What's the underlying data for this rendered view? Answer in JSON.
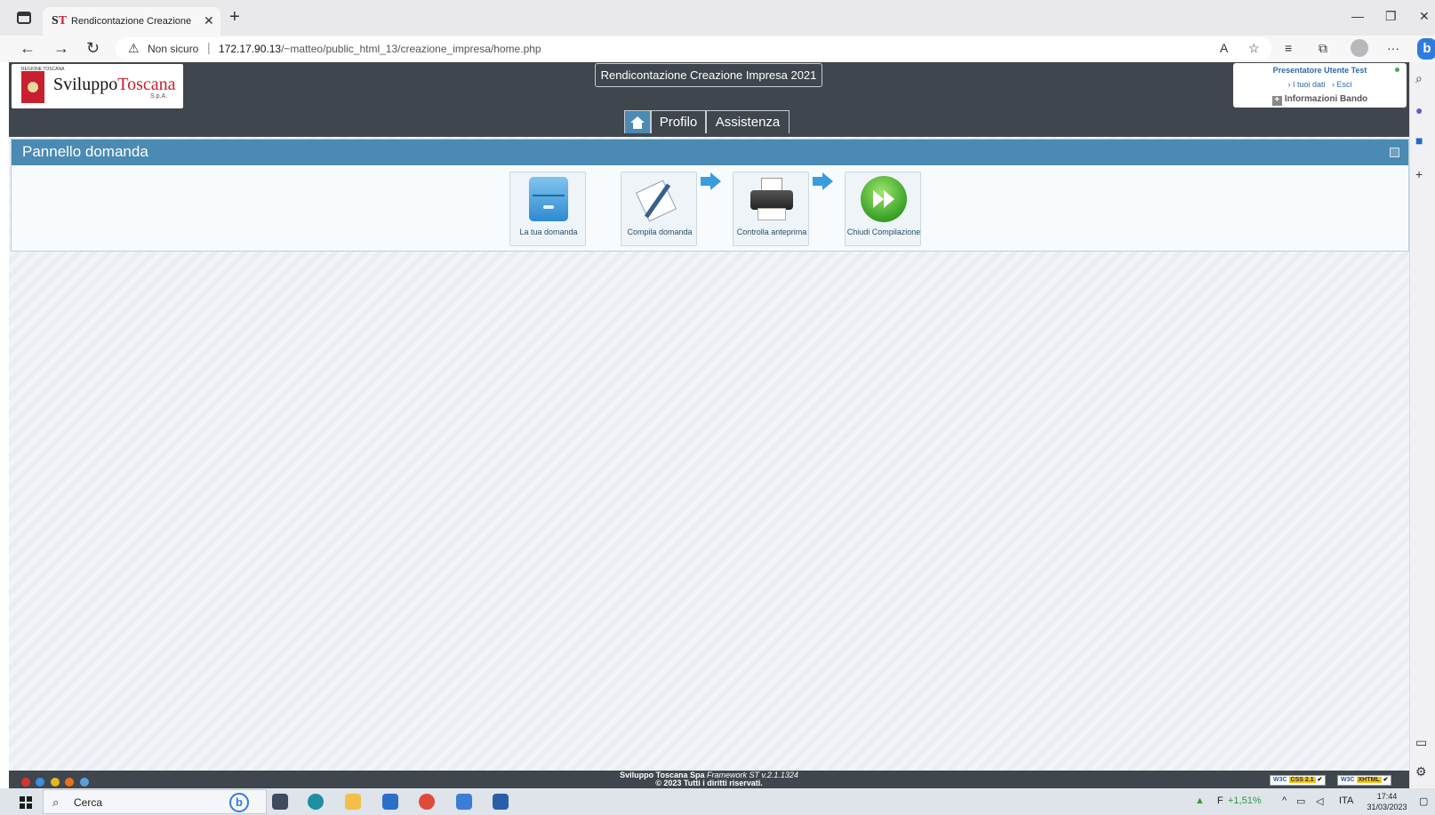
{
  "browser": {
    "tab_title": "Rendicontazione Creazione Impr",
    "tab_fav_s": "S",
    "tab_fav_t": "T",
    "not_secure": "Non sicuro",
    "url_host": "172.17.90.13",
    "url_path": "/~matteo/public_html_13/creazione_impresa/home.php",
    "bing_label": "b"
  },
  "header": {
    "logo_region": "REGIONE TOSCANA",
    "logo_word_a": "Sviluppo",
    "logo_word_b": "Toscana",
    "logo_spa": "S.p.A.",
    "app_title": "Rendicontazione Creazione Impresa 2021",
    "nav": {
      "profilo": "Profilo",
      "assistenza": "Assistenza"
    },
    "user": {
      "line1": "Presentatore Utente Test",
      "my_data": "› I tuoi dati",
      "logout": "› Esci",
      "info": "Informazioni Bando"
    }
  },
  "panel": {
    "title": "Pannello domanda",
    "steps": [
      {
        "label": "La tua domanda",
        "icon": "cabinet-icon"
      },
      {
        "label": "Compila domanda",
        "icon": "pen-paper-icon"
      },
      {
        "label": "Controlla anteprima",
        "icon": "printer-icon"
      },
      {
        "label": "Chiudi Compilazione",
        "icon": "fast-forward-icon"
      }
    ]
  },
  "footer": {
    "company": "Sviluppo Toscana Spa",
    "framework": "Framework ST v.2.1.1324",
    "copyright": "© 2023 Tutti i diritti riservati.",
    "w3c_css": "CSS 2.1",
    "w3c_xhtml": "XHTML",
    "w3c_label": "W3C"
  },
  "taskbar": {
    "search_label": "Cerca",
    "bing_label": "b",
    "stock_letter": "F",
    "stock_change": "+1,51%",
    "lang": "ITA",
    "time": "17:44",
    "date": "31/03/2023"
  },
  "colors": {
    "header_bg": "#3f464d",
    "panel_head": "#4a8ab3",
    "brand_red": "#c8202f",
    "link_blue": "#2f69a8"
  }
}
